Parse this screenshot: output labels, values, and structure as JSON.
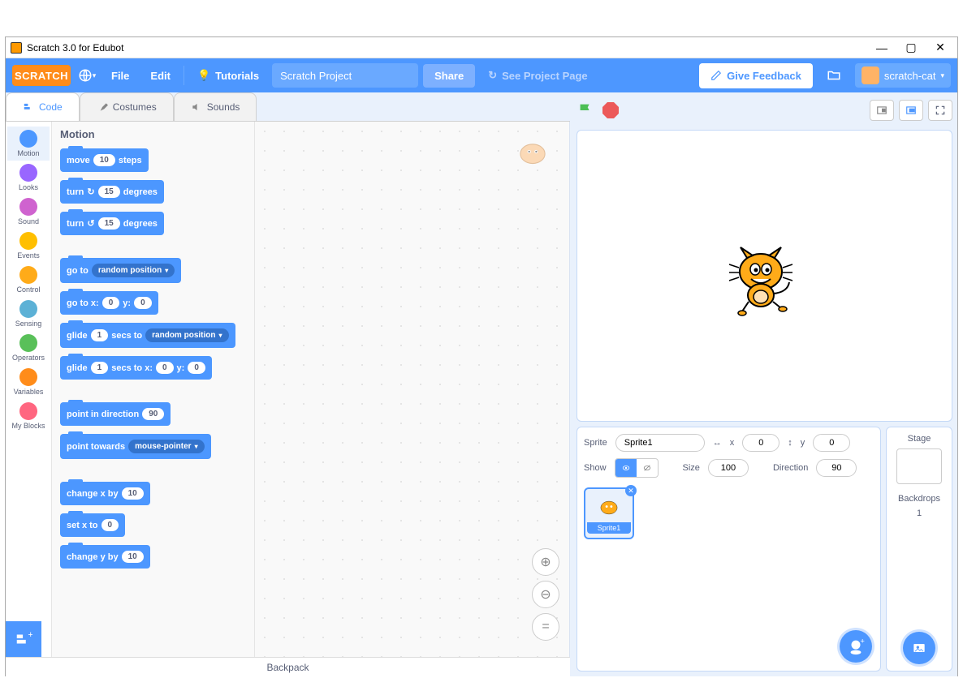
{
  "window": {
    "title": "Scratch 3.0 for Edubot"
  },
  "menu": {
    "logo": "SCRATCH",
    "file": "File",
    "edit": "Edit",
    "tutorials": "Tutorials",
    "project_name": "Scratch Project",
    "share": "Share",
    "see_project": "See Project Page",
    "feedback": "Give Feedback",
    "username": "scratch-cat"
  },
  "tabs": {
    "code": "Code",
    "costumes": "Costumes",
    "sounds": "Sounds"
  },
  "categories": [
    {
      "name": "Motion",
      "color": "#4c97ff"
    },
    {
      "name": "Looks",
      "color": "#9966ff"
    },
    {
      "name": "Sound",
      "color": "#cf63cf"
    },
    {
      "name": "Events",
      "color": "#ffbf00"
    },
    {
      "name": "Control",
      "color": "#ffab19"
    },
    {
      "name": "Sensing",
      "color": "#5cb1d6"
    },
    {
      "name": "Operators",
      "color": "#59c059"
    },
    {
      "name": "Variables",
      "color": "#ff8c1a"
    },
    {
      "name": "My Blocks",
      "color": "#ff6680"
    }
  ],
  "palette_title": "Motion",
  "blocks": {
    "move": {
      "pre": "move",
      "val": "10",
      "post": "steps"
    },
    "turn_cw": {
      "pre": "turn",
      "icon": "↻",
      "val": "15",
      "post": "degrees"
    },
    "turn_ccw": {
      "pre": "turn",
      "icon": "↺",
      "val": "15",
      "post": "degrees"
    },
    "goto": {
      "pre": "go to",
      "drop": "random position"
    },
    "gotoxy": {
      "pre": "go to x:",
      "x": "0",
      "mid": "y:",
      "y": "0"
    },
    "glide": {
      "pre": "glide",
      "secs": "1",
      "mid": "secs to",
      "drop": "random position"
    },
    "glidexy": {
      "pre": "glide",
      "secs": "1",
      "mid": "secs to x:",
      "x": "0",
      "mid2": "y:",
      "y": "0"
    },
    "pointdir": {
      "pre": "point in direction",
      "val": "90"
    },
    "pointtowards": {
      "pre": "point towards",
      "drop": "mouse-pointer"
    },
    "changex": {
      "pre": "change x by",
      "val": "10"
    },
    "setx": {
      "pre": "set x to",
      "val": "0"
    },
    "changey": {
      "pre": "change y by",
      "val": "10"
    }
  },
  "sprite_info": {
    "sprite_label": "Sprite",
    "sprite_name": "Sprite1",
    "x_label": "x",
    "x": "0",
    "y_label": "y",
    "y": "0",
    "show_label": "Show",
    "size_label": "Size",
    "size": "100",
    "direction_label": "Direction",
    "direction": "90"
  },
  "stage_panel": {
    "title": "Stage",
    "backdrops_label": "Backdrops",
    "backdrops_count": "1"
  },
  "backpack": "Backpack"
}
